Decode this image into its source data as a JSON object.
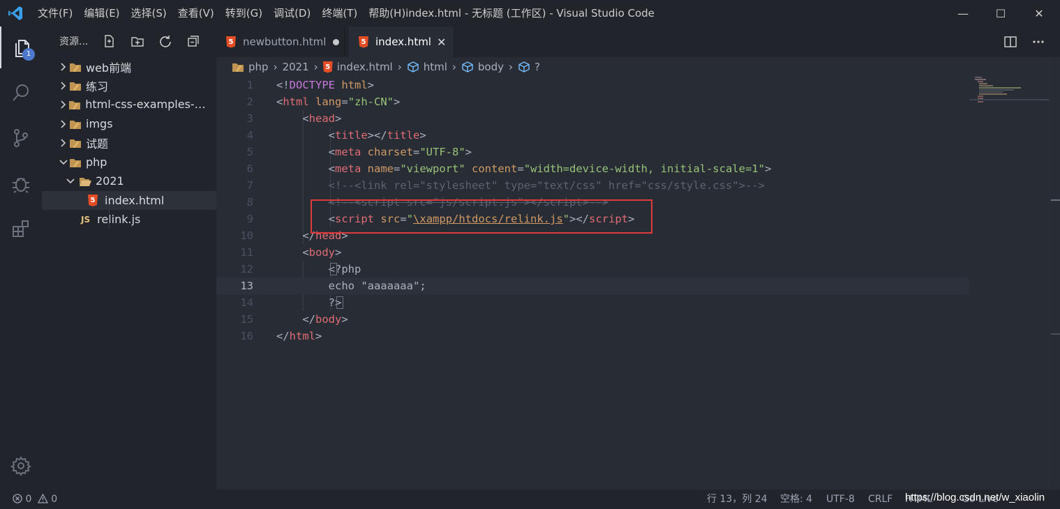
{
  "window": {
    "title": "index.html - 无标题 (工作区) - Visual Studio Code",
    "minimize": "—",
    "maximize": "☐",
    "close": "✕"
  },
  "menu": [
    "文件(F)",
    "编辑(E)",
    "选择(S)",
    "查看(V)",
    "转到(G)",
    "调试(D)",
    "终端(T)",
    "帮助(H)"
  ],
  "activity_bar": {
    "items": [
      "files-icon",
      "search-icon",
      "source-control-icon",
      "debug-icon",
      "extensions-icon"
    ],
    "explorer_badge": "1",
    "settings": "gear-icon"
  },
  "sidebar": {
    "title": "资源...",
    "tools": [
      "new-file-icon",
      "new-folder-icon",
      "refresh-icon",
      "collapse-all-icon"
    ],
    "tree": [
      {
        "label": "web前端",
        "type": "folder",
        "expanded": false,
        "depth": 0
      },
      {
        "label": "练习",
        "type": "folder",
        "expanded": false,
        "depth": 0
      },
      {
        "label": "html-css-examples-ma...",
        "type": "folder",
        "expanded": false,
        "depth": 0
      },
      {
        "label": "imgs",
        "type": "folder",
        "expanded": false,
        "depth": 0
      },
      {
        "label": "试题",
        "type": "folder",
        "expanded": false,
        "depth": 0
      },
      {
        "label": "php",
        "type": "folder",
        "expanded": true,
        "depth": 0
      },
      {
        "label": "2021",
        "type": "folder-open",
        "expanded": true,
        "depth": 1
      },
      {
        "label": "index.html",
        "type": "html",
        "depth": 2,
        "selected": true
      },
      {
        "label": "relink.js",
        "type": "js",
        "depth": 1
      }
    ],
    "js_badge": "JS",
    "html_badge": "5"
  },
  "tabs": [
    {
      "label": "newbutton.html",
      "active": false,
      "dirty": true
    },
    {
      "label": "index.html",
      "active": true,
      "close": "✕"
    }
  ],
  "breadcrumbs": [
    "php",
    "2021",
    "index.html",
    "html",
    "body",
    "?"
  ],
  "editor": {
    "line_numbers": [
      "1",
      "2",
      "3",
      "4",
      "5",
      "6",
      "7",
      "8",
      "9",
      "10",
      "11",
      "12",
      "13",
      "14",
      "15",
      "16"
    ],
    "current_line": 13
  },
  "status": {
    "errors": "0",
    "warnings": "0",
    "position": "行 13，列 24",
    "spaces": "空格: 4",
    "encoding": "UTF-8",
    "eol": "CRLF",
    "language": "HTML",
    "go_live": "Go Live",
    "watermark": "https://blog.csdn.net/w_xiaolin"
  },
  "colors": {
    "accent_box": "#e0393a",
    "badge": "#4d78cc",
    "html_icon": "#e44d26",
    "js_icon": "#e5c07b"
  }
}
